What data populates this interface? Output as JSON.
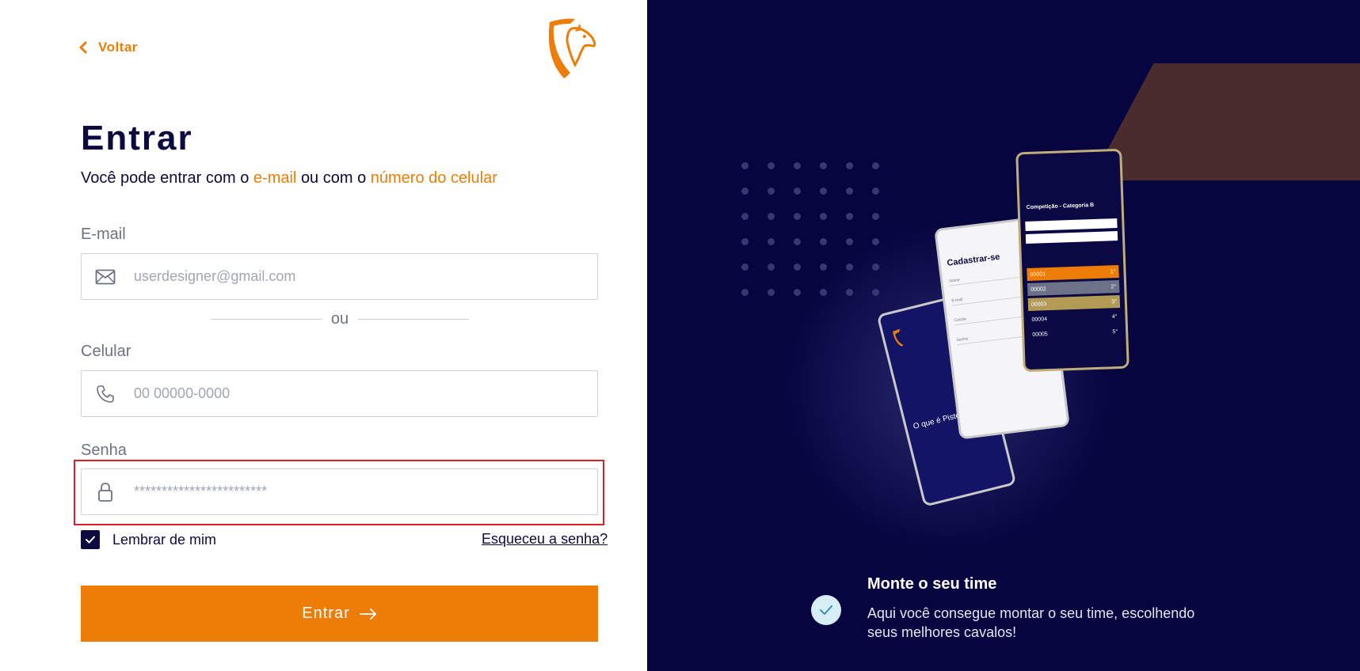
{
  "back": {
    "label": "Voltar"
  },
  "login": {
    "title": "Entrar",
    "subtitle_prefix": "Você pode entrar com o",
    "subtitle_email": "e-mail",
    "subtitle_mid": "ou com o",
    "subtitle_phone": "número do celular"
  },
  "email": {
    "label": "E-mail",
    "placeholder": "userdesigner@gmail.com",
    "icon": "mail-icon"
  },
  "divider": {
    "label": "ou"
  },
  "phone": {
    "label": "Celular",
    "placeholder": "00 00000-0000",
    "icon": "phone-icon"
  },
  "password": {
    "label": "Senha",
    "placeholder": "************************",
    "icon": "lock-icon"
  },
  "remember": {
    "label": "Lembrar de mim",
    "checked": true
  },
  "forgot": {
    "label": "Esqueceu a senha?"
  },
  "submit": {
    "label": "Entrar"
  },
  "feature": {
    "title": "Monte o seu time",
    "description": "Aqui você consegue montar o seu time, escolhendo seus melhores cavalos!"
  },
  "mockups": {
    "screen_register_title": "Cadastrar-se",
    "screen_ranking_title": "Competição - Categoria B",
    "screen_about_title": "O que é Pisteiro?"
  },
  "colors": {
    "accent": "#ee7d08",
    "navy": "#0c0a3e",
    "right_bg": "#070540",
    "highlight": "#e01e25"
  }
}
